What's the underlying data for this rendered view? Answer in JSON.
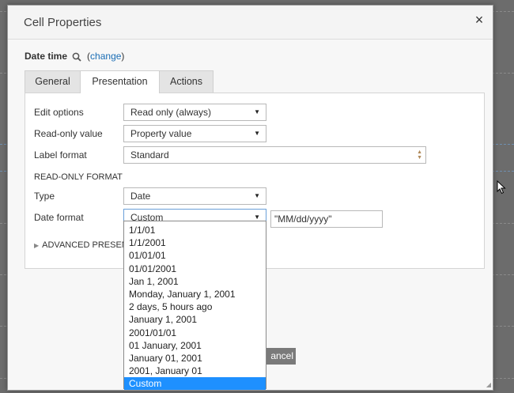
{
  "dialog": {
    "title": "Cell Properties",
    "close_glyph": "×",
    "field_name": "Date time",
    "change_link": "change",
    "paren_open": "(",
    "paren_close": ")"
  },
  "tabs": [
    {
      "label": "General",
      "active": false
    },
    {
      "label": "Presentation",
      "active": true
    },
    {
      "label": "Actions",
      "active": false
    }
  ],
  "form": {
    "edit_options_label": "Edit options",
    "edit_options_value": "Read only (always)",
    "readonly_value_label": "Read-only value",
    "readonly_value_value": "Property value",
    "label_format_label": "Label format",
    "label_format_value": "Standard",
    "section_title": "READ-ONLY FORMAT",
    "type_label": "Type",
    "type_value": "Date",
    "date_format_label": "Date format",
    "date_format_value": "Custom",
    "custom_pattern": "\"MM/dd/yyyy\"",
    "advanced_label": "ADVANCED PRESEN"
  },
  "dropdown": {
    "options": [
      "1/1/01",
      "1/1/2001",
      "01/01/01",
      "01/01/2001",
      "Jan 1, 2001",
      "Monday, January 1, 2001",
      "2 days, 5 hours ago",
      "January 1, 2001",
      "2001/01/01",
      "01 January, 2001",
      "January 01, 2001",
      "2001, January 01",
      "Custom"
    ],
    "selected_index": 12
  },
  "footer": {
    "cancel_label": "ancel"
  },
  "colors": {
    "accent": "#1e90ff",
    "link": "#1a6db5"
  }
}
